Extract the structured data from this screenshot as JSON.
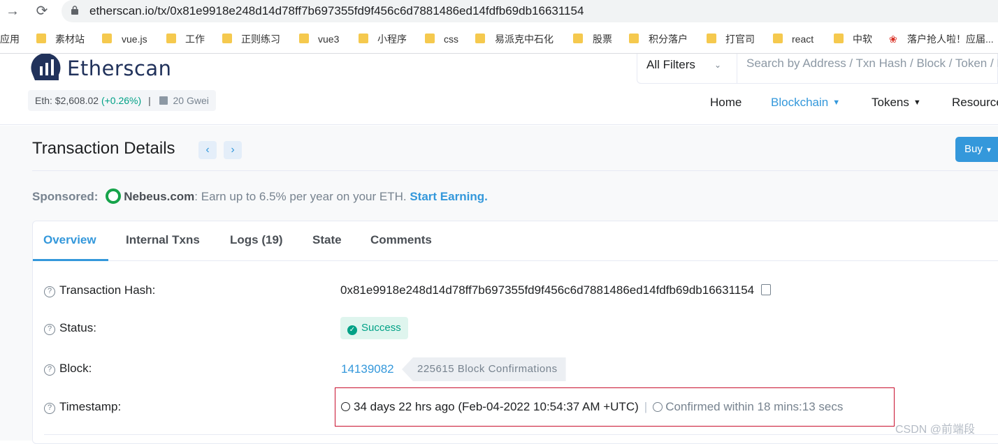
{
  "browser": {
    "url": "etherscan.io/tx/0x81e9918e248d14d78ff7b697355fd9f456c6d7881486ed14fdfb69db16631154",
    "apps_label": "应用",
    "bookmarks": [
      "素材站",
      "vue.js",
      "工作",
      "正则练习",
      "vue3",
      "小程序",
      "css",
      "易派克中石化",
      "股票",
      "积分落户",
      "打官司",
      "react",
      "中软",
      "落户抢人啦！应届..."
    ]
  },
  "header": {
    "logo_text": "Etherscan",
    "eth_price_label": "Eth: $2,608.02",
    "eth_change": "(+0.26%)",
    "separator": "|",
    "gas": "20 Gwei",
    "filter_label": "All Filters",
    "search_placeholder": "Search by Address / Txn Hash / Block / Token / Ens",
    "nav": [
      "Home",
      "Blockchain",
      "Tokens",
      "Resources"
    ]
  },
  "page": {
    "title": "Transaction Details",
    "prev_icon": "‹",
    "next_icon": "›",
    "buy_label": "Buy",
    "sponsored_label": "Sponsored:",
    "sponsor_brand": "Nebeus.com",
    "sponsor_text": ": Earn up to 6.5% per year on your ETH.",
    "sponsor_cta": "Start Earning."
  },
  "tabs": [
    "Overview",
    "Internal Txns",
    "Logs (19)",
    "State",
    "Comments"
  ],
  "details": {
    "hash_label": "Transaction Hash:",
    "hash_value": "0x81e9918e248d14d78ff7b697355fd9f456c6d7881486ed14fdfb69db16631154",
    "status_label": "Status:",
    "status_value": "Success",
    "block_label": "Block:",
    "block_value": "14139082",
    "block_confirmations": "225615 Block Confirmations",
    "timestamp_label": "Timestamp:",
    "timestamp_value": "34 days 22 hrs ago (Feb-04-2022 10:54:37 AM +UTC)",
    "timestamp_sep": "|",
    "timestamp_confirmed": "Confirmed within 18 mins:13 secs"
  },
  "watermark": "CSDN @前端段",
  "colors": {
    "accent": "#3498db",
    "success": "#00a186",
    "highlight_border": "#c8102e"
  }
}
